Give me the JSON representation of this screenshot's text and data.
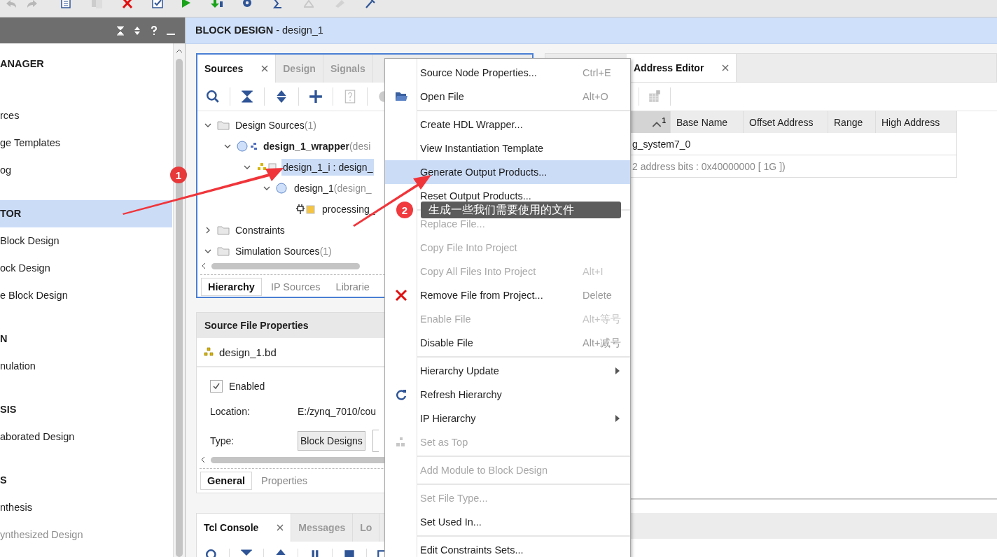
{
  "sidebar": {
    "items": [
      {
        "kind": "header",
        "label": "ANAGER",
        "selected": false,
        "disabled": false
      },
      {
        "kind": "item",
        "label": "rces",
        "selected": false,
        "disabled": false
      },
      {
        "kind": "item",
        "label": "ge Templates",
        "selected": false,
        "disabled": false
      },
      {
        "kind": "item",
        "label": "og",
        "selected": false,
        "disabled": false
      },
      {
        "kind": "header",
        "label": "TOR",
        "selected": true,
        "disabled": false
      },
      {
        "kind": "item",
        "label": "Block Design",
        "selected": false,
        "disabled": false
      },
      {
        "kind": "item",
        "label": "ock Design",
        "selected": false,
        "disabled": false
      },
      {
        "kind": "item",
        "label": "e Block Design",
        "selected": false,
        "disabled": false
      },
      {
        "kind": "header",
        "label": "N",
        "selected": false,
        "disabled": false
      },
      {
        "kind": "item",
        "label": "nulation",
        "selected": false,
        "disabled": false
      },
      {
        "kind": "header",
        "label": "SIS",
        "selected": false,
        "disabled": false
      },
      {
        "kind": "item",
        "label": "aborated Design",
        "selected": false,
        "disabled": false
      },
      {
        "kind": "header",
        "label": "S",
        "selected": false,
        "disabled": false
      },
      {
        "kind": "item",
        "label": "nthesis",
        "selected": false,
        "disabled": false
      },
      {
        "kind": "item",
        "label": "ynthesized Design",
        "selected": false,
        "disabled": true
      }
    ]
  },
  "header": {
    "title": "**BLOCK DESIGN** - design_1"
  },
  "sources_panel": {
    "tabs": [
      {
        "label": "Sources",
        "selected": true,
        "closable": true
      },
      {
        "label": "Design",
        "selected": false,
        "closable": false
      },
      {
        "label": "Signals",
        "selected": false,
        "closable": false
      }
    ],
    "tree": [
      {
        "kind": "folder",
        "label": "Design Sources",
        "detail": "(1)",
        "expanded": true,
        "selected": false,
        "children": [
          {
            "kind": "wrapper",
            "label": "design_1_wrapper",
            "detail": "(desi",
            "expanded": true,
            "selected": false,
            "children": [
              {
                "kind": "instance",
                "label": "design_1_i : design_",
                "expanded": true,
                "selected": true,
                "children": [
                  {
                    "kind": "design",
                    "label": "design_1",
                    "detail": "(design_",
                    "expanded": true,
                    "selected": false,
                    "children": [
                      {
                        "kind": "ip",
                        "label": "processing_",
                        "selected": false
                      }
                    ]
                  }
                ]
              }
            ]
          }
        ]
      },
      {
        "kind": "folder",
        "label": "Constraints",
        "expanded": false,
        "selected": false
      },
      {
        "kind": "folder",
        "label": "Simulation Sources",
        "detail": "(1)",
        "expanded": true,
        "selected": false
      }
    ],
    "bottom_tabs": [
      {
        "label": "Hierarchy",
        "selected": true
      },
      {
        "label": "IP Sources",
        "selected": false
      },
      {
        "label": "Librarie",
        "selected": false
      }
    ]
  },
  "file_properties": {
    "title": "Source File Properties",
    "file": "design_1.bd",
    "enabled": {
      "label": "Enabled",
      "checked": true
    },
    "fields": [
      {
        "kind": "text",
        "label": "Location:",
        "value": "E:/zynq_7010/cou"
      },
      {
        "kind": "box",
        "label": "Type:",
        "value": "Block Designs"
      }
    ],
    "tabs": [
      {
        "label": "General",
        "selected": true
      },
      {
        "label": "Properties",
        "selected": false
      }
    ]
  },
  "console": {
    "tabs": [
      {
        "label": "Tcl Console",
        "selected": true,
        "closable": true
      },
      {
        "label": "Messages",
        "selected": false,
        "closable": false
      },
      {
        "label": "Lo",
        "selected": false,
        "closable": false
      }
    ]
  },
  "address_editor": {
    "tab": {
      "label": "Address Editor",
      "selected": true
    },
    "sort_order": "1",
    "columns": [
      "Base Name",
      "Offset Address",
      "Range",
      "High Address"
    ],
    "rows": [
      {
        "kind": "cell",
        "text": "g_system7_0"
      },
      {
        "kind": "note",
        "text": "2 address bits : 0x40000000 [ 1G ])"
      }
    ]
  },
  "context_menu": {
    "items": [
      {
        "kind": "plain",
        "label": "Source Node Properties...",
        "shortcut": "Ctrl+E",
        "disabled": false,
        "selected": false,
        "submenu": false
      },
      {
        "kind": "folder",
        "label": "Open File",
        "shortcut": "Alt+O",
        "disabled": false,
        "selected": false,
        "submenu": false
      },
      {
        "kind": "separator"
      },
      {
        "kind": "plain",
        "label": "Create HDL Wrapper...",
        "disabled": false,
        "selected": false,
        "submenu": false
      },
      {
        "kind": "plain",
        "label": "View Instantiation Template",
        "disabled": false,
        "selected": false,
        "submenu": false
      },
      {
        "kind": "plain",
        "label": "Generate Output Products...",
        "disabled": false,
        "selected": true,
        "submenu": false
      },
      {
        "kind": "plain",
        "label": "Reset Output Products...",
        "disabled": false,
        "selected": false,
        "submenu": false
      },
      {
        "kind": "separator"
      },
      {
        "kind": "plain",
        "label": "Replace File...",
        "disabled": true,
        "selected": false,
        "submenu": false
      },
      {
        "kind": "plain",
        "label": "Copy File Into Project",
        "disabled": true,
        "selected": false,
        "submenu": false
      },
      {
        "kind": "plain",
        "label": "Copy All Files Into Project",
        "shortcut": "Alt+I",
        "disabled": true,
        "selected": false,
        "submenu": false
      },
      {
        "kind": "remove",
        "label": "Remove File from Project...",
        "shortcut": "Delete",
        "disabled": false,
        "selected": false,
        "submenu": false
      },
      {
        "kind": "plain",
        "label": "Enable File",
        "shortcut": "Alt+等号",
        "disabled": true,
        "selected": false,
        "submenu": false
      },
      {
        "kind": "plain",
        "label": "Disable File",
        "shortcut": "Alt+减号",
        "disabled": false,
        "selected": false,
        "submenu": false
      },
      {
        "kind": "separator"
      },
      {
        "kind": "plain",
        "label": "Hierarchy Update",
        "disabled": false,
        "selected": false,
        "submenu": true
      },
      {
        "kind": "refresh",
        "label": "Refresh Hierarchy",
        "disabled": false,
        "selected": false,
        "submenu": false
      },
      {
        "kind": "plain",
        "label": "IP Hierarchy",
        "disabled": false,
        "selected": false,
        "submenu": true
      },
      {
        "kind": "hierarchy",
        "label": "Set as Top",
        "disabled": true,
        "selected": false,
        "submenu": false
      },
      {
        "kind": "separator"
      },
      {
        "kind": "plain",
        "label": "Add Module to Block Design",
        "disabled": true,
        "selected": false,
        "submenu": false
      },
      {
        "kind": "separator"
      },
      {
        "kind": "plain",
        "label": "Set File Type...",
        "disabled": true,
        "selected": false,
        "submenu": false
      },
      {
        "kind": "plain",
        "label": "Set Used In...",
        "disabled": false,
        "selected": false,
        "submenu": false
      },
      {
        "kind": "separator"
      },
      {
        "kind": "plain",
        "label": "Edit Constraints Sets...",
        "disabled": false,
        "selected": false,
        "submenu": false
      }
    ]
  },
  "annotations": [
    {
      "number": "1"
    },
    {
      "number": "2",
      "text": "生成一些我们需要使用的文件"
    }
  ]
}
